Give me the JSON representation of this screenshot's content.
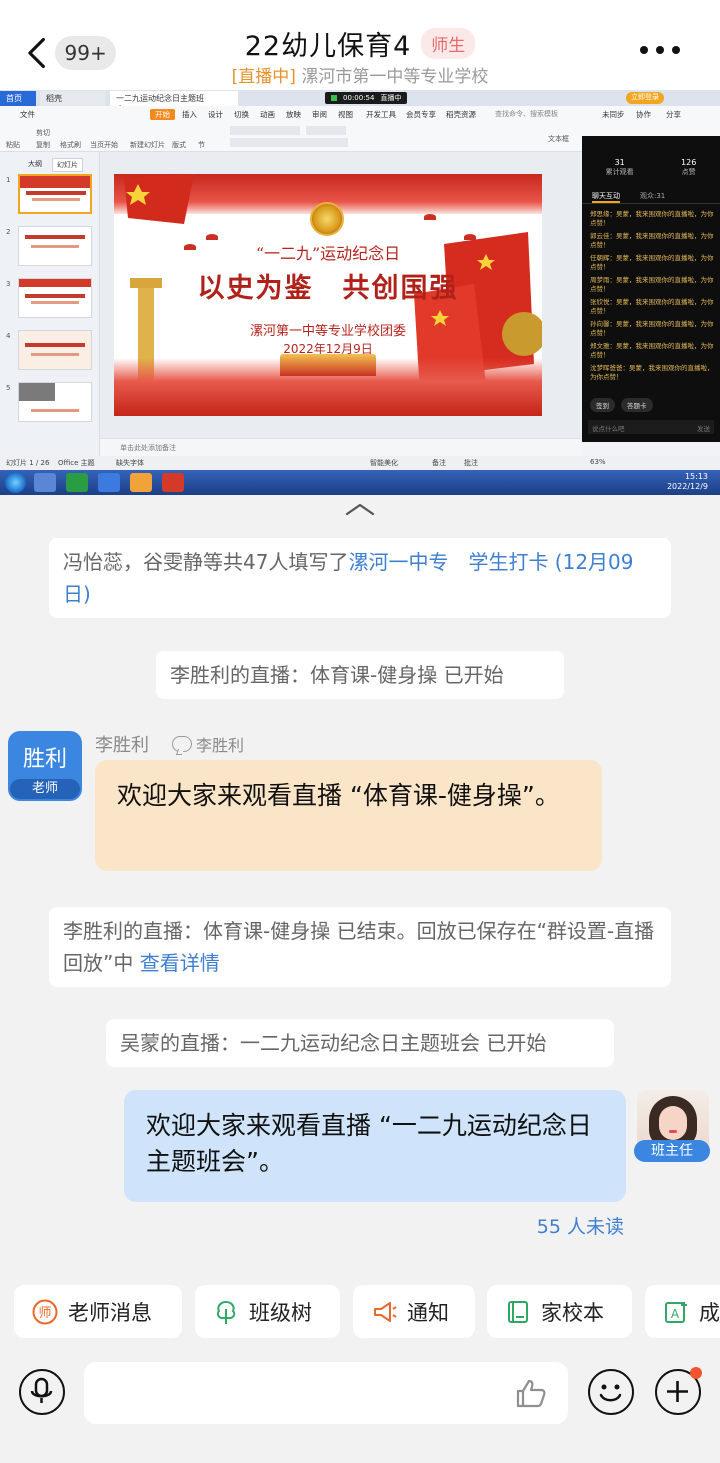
{
  "header": {
    "back_badge": "99+",
    "title": "22幼儿保育4",
    "role_tag": "师生",
    "live_label": "[直播中]",
    "school": "漯河市第一中等专业学校"
  },
  "stream": {
    "tabs": {
      "home": "首页",
      "docer": "稻壳",
      "doc": "一二九运动纪念日主题班会.pptx"
    },
    "timer": "00:00:54",
    "live_state": "直播中",
    "login": "立即登录",
    "menu": [
      "文件",
      "开始",
      "插入",
      "设计",
      "切换",
      "动画",
      "放映",
      "审阅",
      "视图",
      "开发工具",
      "会员专享",
      "稻壳资源"
    ],
    "search": "查找命令、搜索模板",
    "right_menu": [
      "未同步",
      "协作",
      "分享"
    ],
    "tools": [
      "粘贴",
      "剪切",
      "复制",
      "格式刷",
      "当页开始",
      "新建幻灯片",
      "版式",
      "节",
      "文本框"
    ],
    "side_tabs": [
      "大纲",
      "幻灯片"
    ],
    "slide_numbers": [
      "1",
      "2",
      "3",
      "4",
      "5"
    ],
    "slide": {
      "subtitle": "“一二九”运动纪念日",
      "main": "以史为鉴　共创国强",
      "org": "漯河第一中等专业学校团委",
      "date": "2022年12月9日"
    },
    "notes_hint": "单击此处添加备注",
    "status": {
      "slide_count": "幻灯片 1 / 26",
      "theme": "Office 主题",
      "font": "缺失字体",
      "beautify": "智能美化",
      "notes": "备注",
      "comments": "批注",
      "zoom": "63%"
    },
    "taskbar_clock": {
      "time": "15:13",
      "date": "2022/12/9"
    },
    "live_panel": {
      "stats": [
        {
          "value": "31",
          "label": "累计观看"
        },
        {
          "value": "126",
          "label": "点赞"
        }
      ],
      "tabs": [
        "聊天互动",
        "观众:31"
      ],
      "messages": [
        "郑思缘：吴蒙，我来围观你的直播啦，为你点赞！",
        "郭云佳：吴蒙，我来围观你的直播啦，为你点赞！",
        "任朝辉：吴蒙，我来围观你的直播啦，为你点赞！",
        "周梦雨：吴蒙，我来围观你的直播啦，为你点赞！",
        "张欣悦：吴蒙，我来围观你的直播啦，为你点赞！",
        "孙向馨：吴蒙，我来围观你的直播啦，为你点赞！",
        "郑文雅：吴蒙，我来围观你的直播啦，为你点赞！",
        "沈梦晖爸爸：吴蒙，我来围观你的直播啦，为你点赞！"
      ],
      "buttons": [
        "签到",
        "答题卡"
      ],
      "input_placeholder": "说点什么吧",
      "send": "发送"
    }
  },
  "chat": {
    "checkin_prefix": "冯怡蕊，谷雯静等共47人填写了",
    "checkin_link": "漯河一中专　学生打卡 (12月09日)",
    "live1_start": "李胜利的直播：体育课-健身操 已开始",
    "teacher": {
      "avatar_text": "胜利",
      "avatar_role": "老师",
      "name": "李胜利",
      "tag": "李胜利"
    },
    "teacher_msg": "欢迎大家来观看直播 “体育课-健身操”。",
    "live1_end_prefix": "李胜利的直播：体育课-健身操 已结束。回放已保存在“群设置-直播回放”中 ",
    "live1_end_link": "查看详情",
    "live2_start": "吴蒙的直播：一二九运动纪念日主题班会 已开始",
    "my_msg": "欢迎大家来观看直播 “一二九运动纪念日主题班会”。",
    "my_tag": "班主任",
    "unread": "55 人未读"
  },
  "chips": [
    "老师消息",
    "班级树",
    "通知",
    "家校本",
    "成"
  ],
  "input": {
    "placeholder": ""
  },
  "colors": {
    "accent_blue": "#3a86e0",
    "live_orange": "#e7932a",
    "teacher_bubble": "#fbe5c8",
    "my_bubble": "#cfe4fa",
    "unread_dot": "#f2542e"
  }
}
